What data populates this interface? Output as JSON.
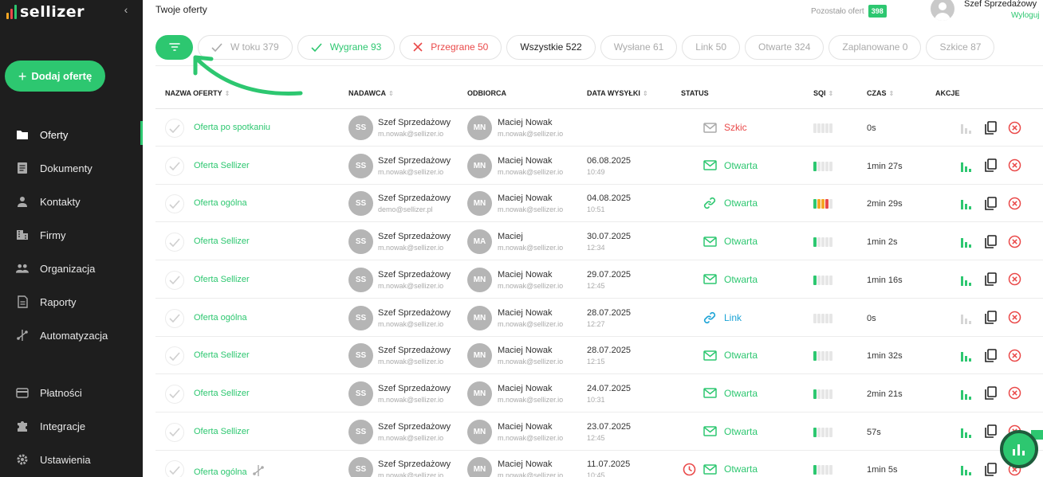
{
  "brand": {
    "name": "sellizer",
    "accent": "#2dc770",
    "danger": "#ea4949",
    "link_blue": "#1ba3d6",
    "sidebar_bg": "#1e1e1e"
  },
  "sidebar": {
    "collapse_icon": "chevron-left-icon",
    "add_button": "Dodaj ofertę",
    "items": [
      {
        "label": "Oferty",
        "icon": "folder-icon",
        "active": true
      },
      {
        "label": "Dokumenty",
        "icon": "document-icon"
      },
      {
        "label": "Kontakty",
        "icon": "person-icon"
      },
      {
        "label": "Firmy",
        "icon": "building-icon"
      },
      {
        "label": "Organizacja",
        "icon": "people-icon"
      },
      {
        "label": "Raporty",
        "icon": "report-icon"
      },
      {
        "label": "Automatyzacja",
        "icon": "automation-icon"
      }
    ],
    "bottom_items": [
      {
        "label": "Płatności",
        "icon": "card-icon"
      },
      {
        "label": "Integracje",
        "icon": "puzzle-icon"
      },
      {
        "label": "Ustawienia",
        "icon": "gear-icon"
      }
    ]
  },
  "header": {
    "title": "Twoje oferty",
    "remaining_label": "Pozostało ofert",
    "remaining_count": "398",
    "user_name": "Szef Sprzedażowy",
    "logout": "Wyloguj"
  },
  "filters": [
    {
      "label": "W toku 379",
      "icon": "check-icon",
      "kind": "muted"
    },
    {
      "label": "Wygrane 93",
      "icon": "check-icon",
      "kind": "won"
    },
    {
      "label": "Przegrane 50",
      "icon": "x-icon",
      "kind": "lost"
    },
    {
      "label": "Wszystkie 522",
      "icon": "",
      "kind": "all"
    },
    {
      "label": "Wysłane 61",
      "icon": "",
      "kind": "muted"
    },
    {
      "label": "Link 50",
      "icon": "",
      "kind": "muted"
    },
    {
      "label": "Otwarte 324",
      "icon": "",
      "kind": "muted"
    },
    {
      "label": "Zaplanowane 0",
      "icon": "",
      "kind": "muted"
    },
    {
      "label": "Szkice 87",
      "icon": "",
      "kind": "muted"
    }
  ],
  "table": {
    "columns": {
      "name": "NAZWA OFERTY",
      "sender": "NADAWCA",
      "recipient": "ODBIORCA",
      "sent_date": "DATA WYSYŁKI",
      "status": "STATUS",
      "sqi": "SQI",
      "time": "CZAS",
      "actions": "AKCJE"
    },
    "sort_glyph": "⇕",
    "rows": [
      {
        "name": "Oferta po spotkaniu",
        "sender_initials": "SS",
        "sender_name": "Szef Sprzedażowy",
        "sender_email": "m.nowak@sellizer.io",
        "recipient_initials": "MN",
        "recipient_name": "Maciej Nowak",
        "recipient_email": "m.nowak@sellizer.io",
        "date": "",
        "time": "",
        "status": "Szkic",
        "status_kind": "draft",
        "status_icon": "mail-icon",
        "sqi": 0,
        "duration": "0s",
        "chart_active": false
      },
      {
        "name": "Oferta Sellizer",
        "sender_initials": "SS",
        "sender_name": "Szef Sprzedażowy",
        "sender_email": "m.nowak@sellizer.io",
        "recipient_initials": "MN",
        "recipient_name": "Maciej Nowak",
        "recipient_email": "m.nowak@sellizer.io",
        "date": "06.08.2025",
        "time": "10:49",
        "status": "Otwarta",
        "status_kind": "open",
        "status_icon": "mail-icon",
        "sqi": 1,
        "duration": "1min 27s",
        "chart_active": true
      },
      {
        "name": "Oferta ogólna",
        "sender_initials": "SS",
        "sender_name": "Szef Sprzedażowy",
        "sender_email": "demo@sellizer.pl",
        "recipient_initials": "MN",
        "recipient_name": "Maciej Nowak",
        "recipient_email": "m.nowak@sellizer.io",
        "date": "04.08.2025",
        "time": "10:51",
        "status": "Otwarta",
        "status_kind": "open",
        "status_icon": "link-icon",
        "sqi": 4,
        "duration": "2min 29s",
        "chart_active": true
      },
      {
        "name": "Oferta Sellizer",
        "sender_initials": "SS",
        "sender_name": "Szef Sprzedażowy",
        "sender_email": "m.nowak@sellizer.io",
        "recipient_initials": "MA",
        "recipient_name": "Maciej",
        "recipient_email": "m.nowak@sellizer.io",
        "date": "30.07.2025",
        "time": "12:34",
        "status": "Otwarta",
        "status_kind": "open",
        "status_icon": "mail-icon",
        "sqi": 1,
        "duration": "1min 2s",
        "chart_active": true
      },
      {
        "name": "Oferta Sellizer",
        "sender_initials": "SS",
        "sender_name": "Szef Sprzedażowy",
        "sender_email": "m.nowak@sellizer.io",
        "recipient_initials": "MN",
        "recipient_name": "Maciej Nowak",
        "recipient_email": "m.nowak@sellizer.io",
        "date": "29.07.2025",
        "time": "12:45",
        "status": "Otwarta",
        "status_kind": "open",
        "status_icon": "mail-icon",
        "sqi": 1,
        "duration": "1min 16s",
        "chart_active": true
      },
      {
        "name": "Oferta ogólna",
        "sender_initials": "SS",
        "sender_name": "Szef Sprzedażowy",
        "sender_email": "m.nowak@sellizer.io",
        "recipient_initials": "MN",
        "recipient_name": "Maciej Nowak",
        "recipient_email": "m.nowak@sellizer.io",
        "date": "28.07.2025",
        "time": "12:27",
        "status": "Link",
        "status_kind": "link",
        "status_icon": "link-icon",
        "sqi": 0,
        "duration": "0s",
        "chart_active": false
      },
      {
        "name": "Oferta Sellizer",
        "sender_initials": "SS",
        "sender_name": "Szef Sprzedażowy",
        "sender_email": "m.nowak@sellizer.io",
        "recipient_initials": "MN",
        "recipient_name": "Maciej Nowak",
        "recipient_email": "m.nowak@sellizer.io",
        "date": "28.07.2025",
        "time": "12:15",
        "status": "Otwarta",
        "status_kind": "open",
        "status_icon": "mail-icon",
        "sqi": 1,
        "duration": "1min 32s",
        "chart_active": true
      },
      {
        "name": "Oferta Sellizer",
        "sender_initials": "SS",
        "sender_name": "Szef Sprzedażowy",
        "sender_email": "m.nowak@sellizer.io",
        "recipient_initials": "MN",
        "recipient_name": "Maciej Nowak",
        "recipient_email": "m.nowak@sellizer.io",
        "date": "24.07.2025",
        "time": "10:31",
        "status": "Otwarta",
        "status_kind": "open",
        "status_icon": "mail-icon",
        "sqi": 1,
        "duration": "2min 21s",
        "chart_active": true
      },
      {
        "name": "Oferta Sellizer",
        "sender_initials": "SS",
        "sender_name": "Szef Sprzedażowy",
        "sender_email": "m.nowak@sellizer.io",
        "recipient_initials": "MN",
        "recipient_name": "Maciej Nowak",
        "recipient_email": "m.nowak@sellizer.io",
        "date": "23.07.2025",
        "time": "12:45",
        "status": "Otwarta",
        "status_kind": "open",
        "status_icon": "mail-icon",
        "sqi": 1,
        "duration": "57s",
        "chart_active": true
      },
      {
        "name": "Oferta ogólna",
        "sender_initials": "SS",
        "sender_name": "Szef Sprzedażowy",
        "sender_email": "m.nowak@sellizer.io",
        "recipient_initials": "MN",
        "recipient_name": "Maciej Nowak",
        "recipient_email": "m.nowak@sellizer.io",
        "date": "11.07.2025",
        "time": "10:45",
        "status": "Otwarta",
        "status_kind": "open",
        "status_icon": "mail-icon",
        "sqi": 1,
        "duration": "1min 5s",
        "chart_active": true,
        "automation": true,
        "scheduled": true
      }
    ]
  }
}
